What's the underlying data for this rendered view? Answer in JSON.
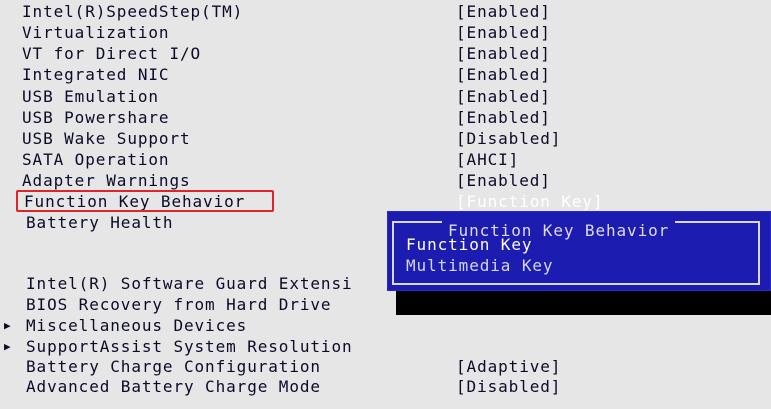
{
  "bios": {
    "settings": [
      {
        "label": "Intel(R)SpeedStep(TM)",
        "value": "[Enabled]"
      },
      {
        "label": "Virtualization",
        "value": "[Enabled]"
      },
      {
        "label": "VT for Direct I/O",
        "value": "[Enabled]"
      },
      {
        "label": "Integrated NIC",
        "value": "[Enabled]"
      },
      {
        "label": "USB Emulation",
        "value": "[Enabled]"
      },
      {
        "label": "USB Powershare",
        "value": "[Enabled]"
      },
      {
        "label": "USB Wake Support",
        "value": "[Disabled]"
      },
      {
        "label": "SATA Operation",
        "value": "[AHCI]"
      },
      {
        "label": "Adapter Warnings",
        "value": "[Enabled]"
      },
      {
        "label": "Function Key Behavior",
        "value": "[Function Key]"
      },
      {
        "label": "Battery Health",
        "value": ""
      },
      {
        "label": "Intel(R) Software Guard Extensi",
        "value": ""
      },
      {
        "label": "BIOS Recovery from Hard Drive",
        "value": ""
      },
      {
        "label": "Miscellaneous Devices",
        "value": "",
        "submenu_marker": "▶"
      },
      {
        "label": "SupportAssist System Resolution",
        "value": "",
        "submenu_marker": "▶"
      },
      {
        "label": "Battery Charge Configuration",
        "value": "[Adaptive]"
      },
      {
        "label": "Advanced Battery Charge Mode",
        "value": "[Disabled]"
      }
    ]
  },
  "dialog": {
    "title": "Function Key Behavior",
    "options": [
      "Function Key",
      "Multimedia Key"
    ],
    "selected": "Function Key"
  },
  "colors": {
    "screen_background": "#e6e6e6",
    "text": "#0b0b2a",
    "dialog_background": "#1c1cb0",
    "highlight_box": "#e0242a"
  }
}
